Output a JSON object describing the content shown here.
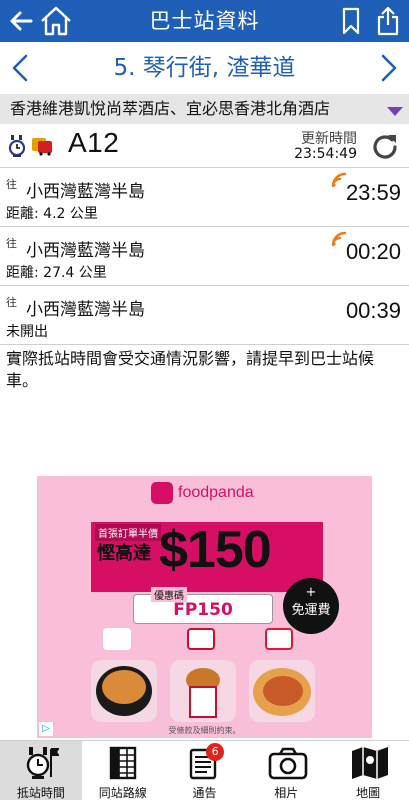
{
  "app_bar": {
    "title": "巴士站資料",
    "icons": [
      "back-arrow-icon",
      "home-icon",
      "bookmark-icon",
      "share-icon"
    ]
  },
  "stop_bar": {
    "name": "5. 琴行街, 渣華道",
    "icons": [
      "chevron-left-icon",
      "chevron-right-icon"
    ]
  },
  "address": {
    "text": "香港維港凱悅尚萃酒店、宜必思香港北角酒店",
    "expand_icon": "triangle-down-icon"
  },
  "route": {
    "number": "A12",
    "icons": [
      "clock-flag-icon",
      "bus-icon"
    ],
    "update_label": "更新時間",
    "update_time": "23:54:49",
    "refresh_icon": "refresh-icon"
  },
  "etas": [
    {
      "direction": "往",
      "destination": "小西灣藍灣半島",
      "detail": "距離: 4.2 公里",
      "time": "23:59",
      "live": true
    },
    {
      "direction": "往",
      "destination": "小西灣藍灣半島",
      "detail": "距離: 27.4 公里",
      "time": "00:20",
      "live": true
    },
    {
      "direction": "往",
      "destination": "小西灣藍灣半島",
      "detail": "未開出",
      "time": "00:39",
      "live": false
    }
  ],
  "notice": "實際抵站時間會受交通情況影響，請提早到巴士站候車。",
  "ad": {
    "brand": "foodpanda",
    "promo_label_small": "首張訂單半價",
    "promo_label_big": "慳高達",
    "promo_amount": "$150",
    "code_label": "優惠碼",
    "code_value": "FP150",
    "free_delivery_plus": "+",
    "free_delivery": "免運費",
    "fine_print": "受條款及細則約束。",
    "colors": {
      "background": "#f9bfd8",
      "accent": "#d70f64"
    }
  },
  "tabs": [
    {
      "label": "抵站時間",
      "icon": "clock-flag-icon",
      "active": true
    },
    {
      "label": "同站路線",
      "icon": "timetable-icon",
      "active": false
    },
    {
      "label": "通告",
      "icon": "notice-icon",
      "badge": "6",
      "active": false
    },
    {
      "label": "相片",
      "icon": "camera-icon",
      "active": false
    },
    {
      "label": "地圖",
      "icon": "map-icon",
      "active": false
    }
  ],
  "colors": {
    "primary": "#1f5fb8",
    "live_signal": "#f07a1a",
    "address_bg": "#e6e6e6"
  }
}
